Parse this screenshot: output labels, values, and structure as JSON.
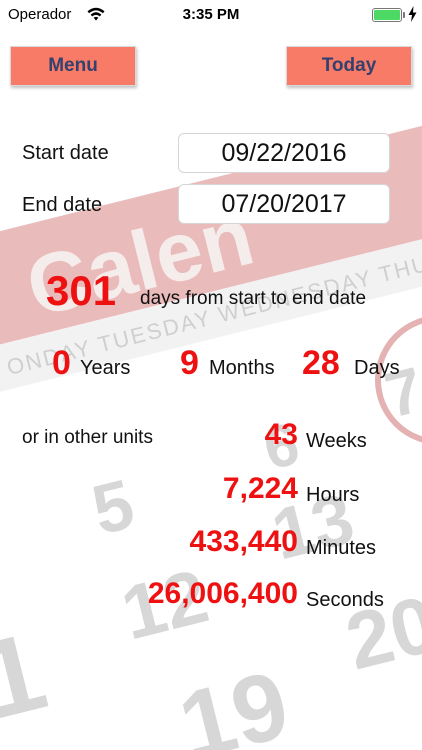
{
  "status_bar": {
    "carrier": "Operador",
    "time": "3:35 PM",
    "battery_level": 1.0
  },
  "toolbar": {
    "menu_label": "Menu",
    "today_label": "Today"
  },
  "dates": {
    "start_label": "Start date",
    "start_value": "09/22/2016",
    "end_label": "End date",
    "end_value": "07/20/2017"
  },
  "result": {
    "days_total": "301",
    "days_caption": "days from start to end date",
    "years": "0",
    "years_label": "Years",
    "months": "9",
    "months_label": "Months",
    "days": "28",
    "days_label": "Days",
    "other_units_label": "or in other units",
    "weeks": "43",
    "weeks_label": "Weeks",
    "hours": "7,224",
    "hours_label": "Hours",
    "minutes": "433,440",
    "minutes_label": "Minutes",
    "seconds": "26,006,400",
    "seconds_label": "Seconds"
  },
  "background": {
    "banner_text": "Calen",
    "weekday_strip": "ONDAY  TUESDAY  WEDNESDAY  THURSDAY",
    "numbers": [
      "7",
      "6",
      "5",
      "13",
      "12",
      "20",
      "1",
      "19"
    ]
  },
  "colors": {
    "accent_red": "#ee1111",
    "button_bg": "#f77b66",
    "button_text": "#34406e",
    "battery_green": "#4cd964"
  }
}
